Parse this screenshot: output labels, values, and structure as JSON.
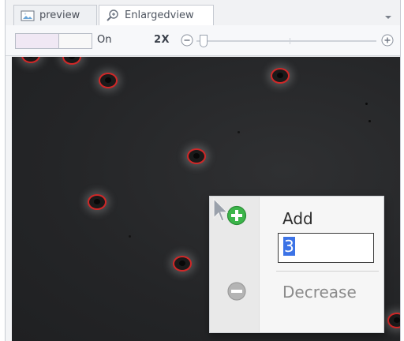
{
  "tabs": [
    {
      "label": "preview",
      "icon": "image-icon",
      "active": false
    },
    {
      "label": "Enlargedview",
      "icon": "zoom-in-icon",
      "active": true
    }
  ],
  "toolbar": {
    "toggle_label": "On",
    "zoom_label": "2X",
    "zoom_minus_icon": "zoom-out-icon",
    "zoom_plus_icon": "zoom-in-icon"
  },
  "context_menu": {
    "add_label": "Add",
    "add_icon": "plus-circle-icon",
    "input_value": "3",
    "decrease_label": "Decrease",
    "decrease_icon": "minus-circle-icon"
  },
  "colors": {
    "accent_blue": "#3c73e6",
    "cell_outline_red": "#d02727",
    "add_icon_green": "#3cb54a",
    "decrease_icon_gray": "#b4b4b4"
  }
}
